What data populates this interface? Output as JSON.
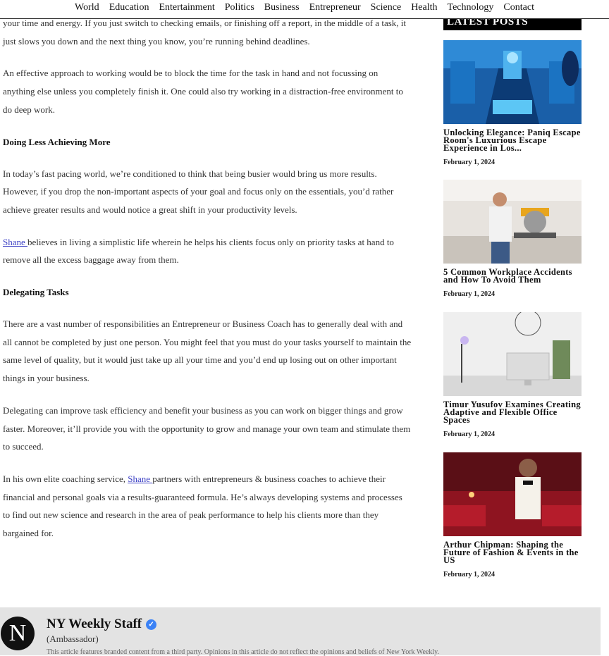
{
  "nav": {
    "items": [
      "World",
      "Education",
      "Entertainment",
      "Politics",
      "Business",
      "Entrepreneur",
      "Science",
      "Health",
      "Technology",
      "Contact"
    ]
  },
  "article": {
    "p1": "your time and energy. If you just switch to checking emails, or finishing off a report, in the middle of a task, it just slows you down and the next thing you know, you’re running behind deadlines.",
    "p2": "An effective approach to working would be to block the time for the task in hand and not focussing on anything else unless you completely finish it. One could also try working in a distraction-free environment to do deep work.",
    "h1": "Doing Less Achieving More",
    "p3": "In today’s fast pacing world, we’re conditioned to think that being busier would bring us more results. However, if you drop the non-important aspects of your goal and focus only on the essentials, you’d rather achieve greater results and would notice a great shift in your productivity levels.",
    "p4_link": "Shane ",
    "p4": "believes in living a simplistic life wherein he helps his clients focus only on priority tasks at hand to remove all the excess baggage away from them.",
    "h2": "Delegating Tasks",
    "p5": "There are a vast number of responsibilities an Entrepreneur or Business Coach has to generally deal with and all cannot be completed by just one person. You might feel that you must do your tasks yourself to maintain the same level of quality, but it would just take up all your time and you’d end up losing out on other important things in your business.",
    "p6": "Delegating can improve task efficiency and benefit your business as you can work on bigger things and grow faster. Moreover, it’ll provide you with the opportunity to grow and manage your own team and stimulate them to succeed.",
    "p7_pre": "In his own elite coaching service, ",
    "p7_link": "Shane ",
    "p7": "partners with  entrepreneurs & business coaches to achieve their financial and personal goals via a results-guaranteed formula. He’s always developing systems and processes to find out new science and research in the area of peak performance to help his clients more than they bargained for."
  },
  "sidebar": {
    "header": "LATEST POSTS",
    "posts": [
      {
        "title": "Unlocking Elegance: Paniq Escape Room's Luxurious Escape Experience in Los...",
        "date": "February 1, 2024"
      },
      {
        "title": "5 Common Workplace Accidents and How To Avoid Them",
        "date": "February 1, 2024"
      },
      {
        "title": "Timur Yusufov Examines Creating Adaptive and Flexible Office Spaces",
        "date": "February 1, 2024"
      },
      {
        "title": "Arthur Chipman: Shaping the Future of Fashion & Events in the US",
        "date": "February 1, 2024"
      }
    ]
  },
  "author": {
    "initial": "N",
    "name": "NY Weekly Staff",
    "role": "(Ambassador)",
    "bio": "This article features branded content from a third party. Opinions in this article do not reflect the opinions and beliefs of New York Weekly."
  },
  "icons": {
    "verified": "verified-badge-icon"
  },
  "colors": {
    "link": "#3b3fc4",
    "header_bg": "#000000",
    "author_bg": "#e3e3e3",
    "verified": "#3b82f6"
  }
}
